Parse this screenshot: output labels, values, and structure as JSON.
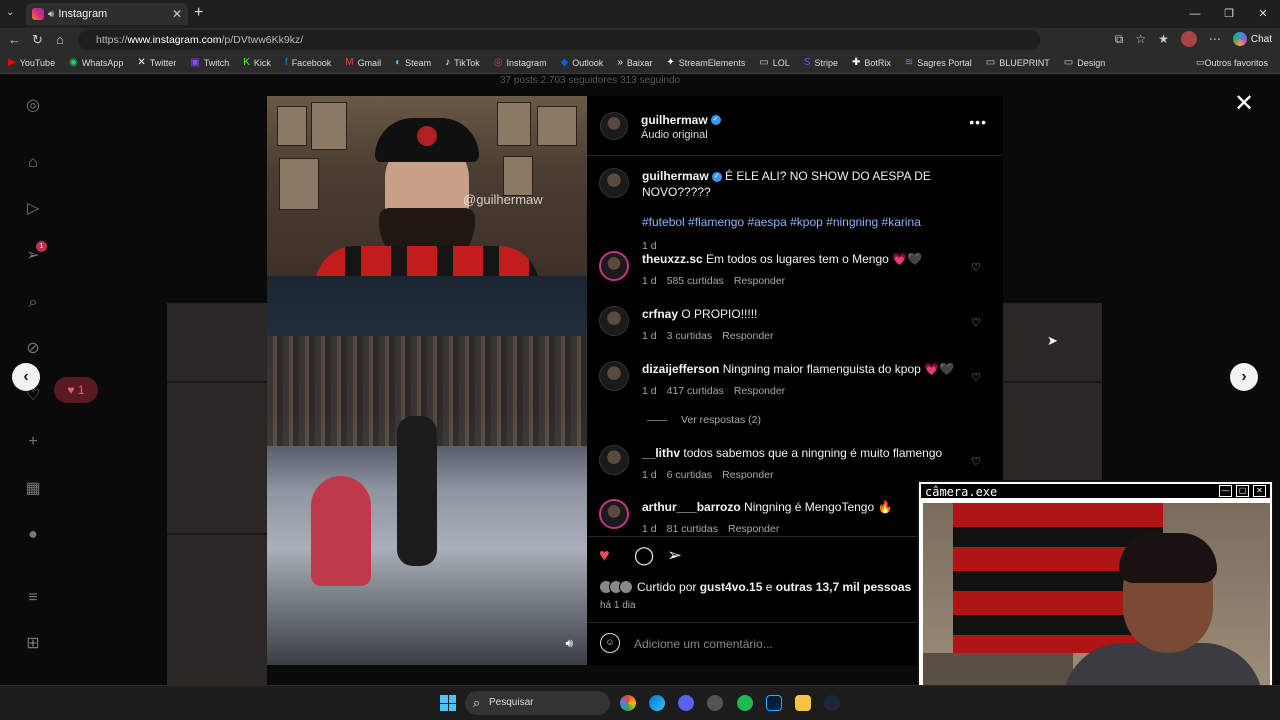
{
  "browser": {
    "tab_title": "Instagram",
    "url_prefix": "https://",
    "url_host": "www.instagram.com",
    "url_path": "/p/DVtww6Kk9kz/",
    "chat_label": "Chat"
  },
  "bookmarks": [
    {
      "label": "YouTube",
      "icon": "▶",
      "color": "#ff0000"
    },
    {
      "label": "WhatsApp",
      "icon": "◉",
      "color": "#25d366"
    },
    {
      "label": "Twitter",
      "icon": "✕",
      "color": "#ffffff"
    },
    {
      "label": "Twitch",
      "icon": "▣",
      "color": "#9146ff"
    },
    {
      "label": "Kick",
      "icon": "K",
      "color": "#53fc18"
    },
    {
      "label": "Facebook",
      "icon": "f",
      "color": "#1877f2"
    },
    {
      "label": "Gmail",
      "icon": "M",
      "color": "#ea4335"
    },
    {
      "label": "Steam",
      "icon": "◐",
      "color": "#66c0f4"
    },
    {
      "label": "TikTok",
      "icon": "♪",
      "color": "#ffffff"
    },
    {
      "label": "Instagram",
      "icon": "◎",
      "color": "#e1306c"
    },
    {
      "label": "Outlook",
      "icon": "◆",
      "color": "#0a64d6"
    },
    {
      "label": "Baixar",
      "icon": "»",
      "color": "#ffffff"
    },
    {
      "label": "StreamElements",
      "icon": "✦",
      "color": "#ffffff"
    },
    {
      "label": "LOL",
      "icon": "▭",
      "color": "#cccccc"
    },
    {
      "label": "Stripe",
      "icon": "S",
      "color": "#635bff"
    },
    {
      "label": "BotRix",
      "icon": "✚",
      "color": "#ffffff"
    },
    {
      "label": "Sagres Portal",
      "icon": "≋",
      "color": "#4a90e2"
    },
    {
      "label": "BLUEPRINT",
      "icon": "▭",
      "color": "#cccccc"
    },
    {
      "label": "Design",
      "icon": "▭",
      "color": "#cccccc"
    }
  ],
  "bookmarks_right": "Outros favoritos",
  "background_profile_stats": "37 posts    2.703 seguidores    313 seguindo",
  "sidebar": {
    "notification_count": "1",
    "like_count": "1"
  },
  "post": {
    "author": "guilhermaw",
    "audio": "Áudio original",
    "watermark": "@guilhermaw",
    "caption": "É ELE ALI? NO SHOW DO AESPA DE NOVO?????",
    "hashtags": "#futebol #flamengo #aespa #kpop #ningning #karina",
    "caption_age": "1 d",
    "liked_by_prefix": "Curtido por",
    "liked_by_user": "gust4vo.15",
    "liked_by_mid": "e",
    "liked_by_rest": "outras 13,7 mil pessoas",
    "posted_when": "há 1 dia",
    "add_comment_placeholder": "Adicione um comentário..."
  },
  "comments": [
    {
      "user": "theuxzz.sc",
      "text": "Em todos os lugares tem o Mengo 💗🖤",
      "age": "1 d",
      "likes": "585 curtidas",
      "reply": "Responder"
    },
    {
      "user": "crfnay",
      "text": "O PROPIO!!!!!",
      "age": "1 d",
      "likes": "3 curtidas",
      "reply": "Responder"
    },
    {
      "user": "dizaijefferson",
      "text": "Ningning maior flamenguista do kpop 💗🖤",
      "age": "1 d",
      "likes": "417 curtidas",
      "reply": "Responder"
    },
    {
      "user": "__lithv",
      "text": "todos sabemos que a ningning é muito flamengo",
      "age": "1 d",
      "likes": "6 curtidas",
      "reply": "Responder"
    },
    {
      "user": "arthur___barrozo",
      "text": "Ningning é MengoTengo 🔥",
      "age": "1 d",
      "likes": "81 curtidas",
      "reply": "Responder"
    }
  ],
  "view_replies": "Ver respostas (2)",
  "camera_overlay": {
    "title": "câmera.exe"
  },
  "taskbar": {
    "search_label": "Pesquisar"
  },
  "colors": {
    "accent_blue": "#3897f0",
    "like_red": "#ed4956"
  }
}
